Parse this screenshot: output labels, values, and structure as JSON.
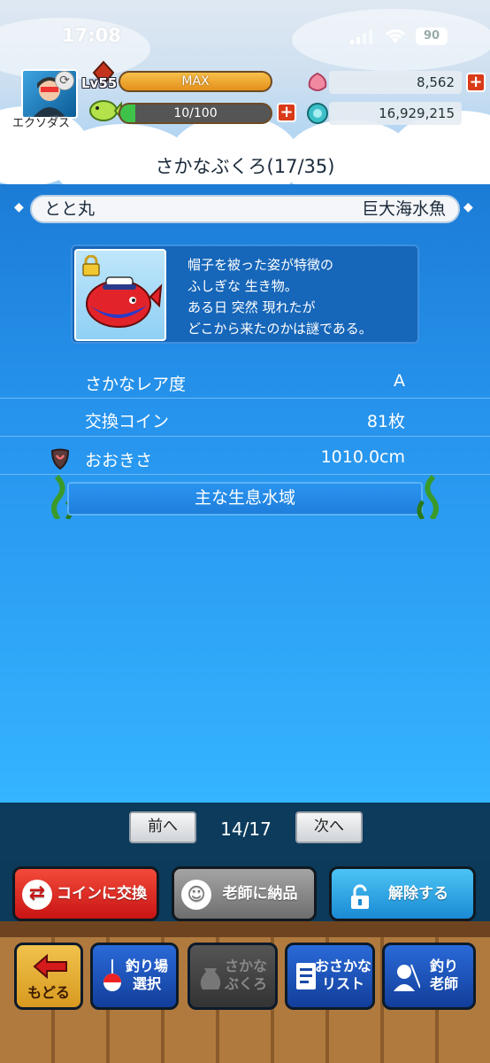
{
  "status_bar": {
    "time": "17:08",
    "battery": "90"
  },
  "player": {
    "name": "エクソダス",
    "level": "Lv55",
    "exp_label": "MAX",
    "stamina": "10/100",
    "stamina_fraction": 0.1
  },
  "resources": {
    "gems": "8,562",
    "coins": "16,929,215"
  },
  "page_title": "さかなぶくろ(17/35)",
  "fish": {
    "name": "とと丸",
    "category": "巨大海水魚",
    "description": [
      "帽子を被った姿が特徴の",
      "ふしぎな 生き物。",
      "ある日 突然 現れたが",
      "どこから来たのかは謎である。"
    ],
    "rows": [
      {
        "label": "さかなレア度",
        "value": "A"
      },
      {
        "label": "交換コイン",
        "value": "81枚"
      },
      {
        "label": "おおきさ",
        "value": "1010.0cm"
      }
    ],
    "habitat_title": "主な生息水域"
  },
  "pager": {
    "prev": "前へ",
    "page": "14/17",
    "next": "次へ"
  },
  "actions": {
    "coin_exchange": "コインに交換",
    "deliver": "老師に納品",
    "unlock": "解除する"
  },
  "nav": {
    "back": "もどる",
    "fishing_spot": [
      "釣り場",
      "選択"
    ],
    "fish_bag": [
      "さかな",
      "ぶくろ"
    ],
    "fish_list": [
      "おさかな",
      "リスト"
    ],
    "master": [
      "釣り",
      "老師"
    ]
  },
  "colors": {
    "coin_button": "#e22a22",
    "deliver_button": "#8a8a8a",
    "unlock_button": "#27a9e8",
    "nav_button": "#1c4fa8"
  }
}
